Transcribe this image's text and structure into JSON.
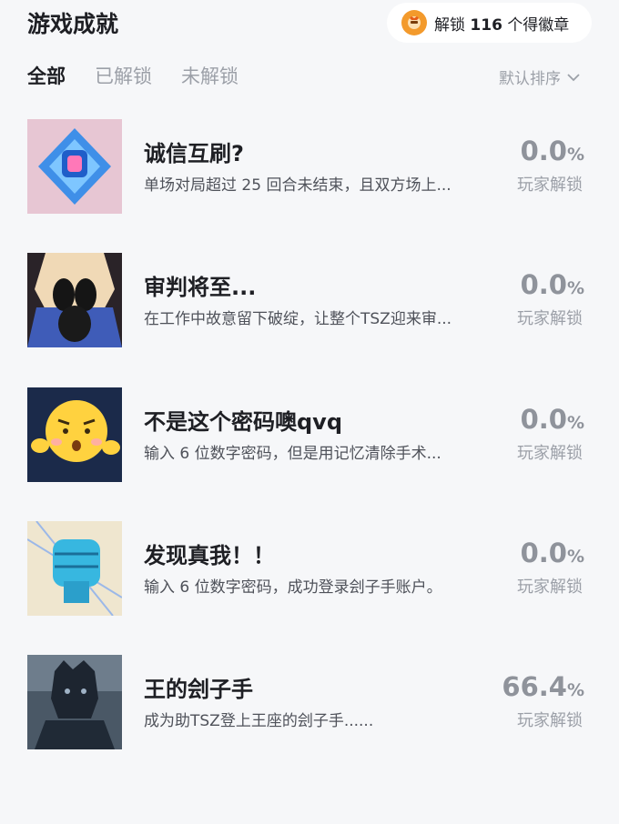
{
  "header": {
    "title": "游戏成就",
    "badge_prefix": "解锁",
    "badge_count": "116",
    "badge_suffix": "个得徽章"
  },
  "tabs": [
    {
      "label": "全部",
      "active": true
    },
    {
      "label": "已解锁",
      "active": false
    },
    {
      "label": "未解锁",
      "active": false
    }
  ],
  "sort": {
    "label": "默认排序"
  },
  "achievements": [
    {
      "title": "诚信互刷?",
      "description": "单场对局超过 25 回合未结束，且双方场上...",
      "percent": "0.0",
      "percent_symbol": "%",
      "percent_label": "玩家解锁",
      "icon": "blue-crystal-icon"
    },
    {
      "title": "审判将至...",
      "description": "在工作中故意留下破绽，让整个TSZ迎来审...",
      "percent": "0.0",
      "percent_symbol": "%",
      "percent_label": "玩家解锁",
      "icon": "masked-figure-icon"
    },
    {
      "title": "不是这个密码噢qvq",
      "description": "输入 6 位数字密码，但是用记忆清除手术...",
      "percent": "0.0",
      "percent_symbol": "%",
      "percent_label": "玩家解锁",
      "icon": "yellow-face-icon"
    },
    {
      "title": "发现真我！！",
      "description": "输入 6 位数字密码，成功登录刽子手账户。",
      "percent": "0.0",
      "percent_symbol": "%",
      "percent_label": "玩家解锁",
      "icon": "fist-icon"
    },
    {
      "title": "王的刽子手",
      "description": "成为助TSZ登上王座的刽子手......",
      "percent": "66.4",
      "percent_symbol": "%",
      "percent_label": "玩家解锁",
      "icon": "executioner-silhouette-icon"
    }
  ]
}
